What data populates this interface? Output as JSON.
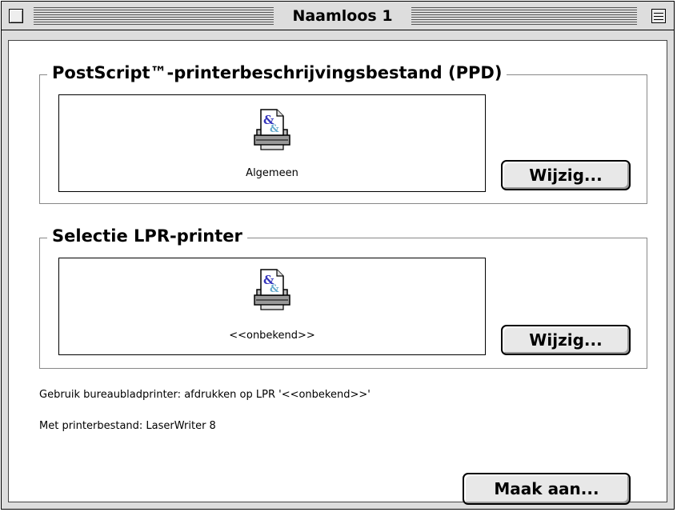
{
  "window": {
    "title": "Naamloos 1"
  },
  "ppd_section": {
    "title": "PostScript™-printerbeschrijvingsbestand (PPD)",
    "file_label": "Algemeen",
    "icon": "printer-document-icon",
    "change_button": "Wijzig..."
  },
  "lpr_section": {
    "title": "Selectie LPR-printer",
    "file_label": "<<onbekend>>",
    "icon": "printer-document-icon",
    "change_button": "Wijzig..."
  },
  "info": {
    "desktop_printer": "Gebruik bureaubladprinter: afdrukken op LPR  '<<onbekend>>'",
    "printer_file": "Met printerbestand:  LaserWriter 8"
  },
  "create_button": "Maak aan..."
}
